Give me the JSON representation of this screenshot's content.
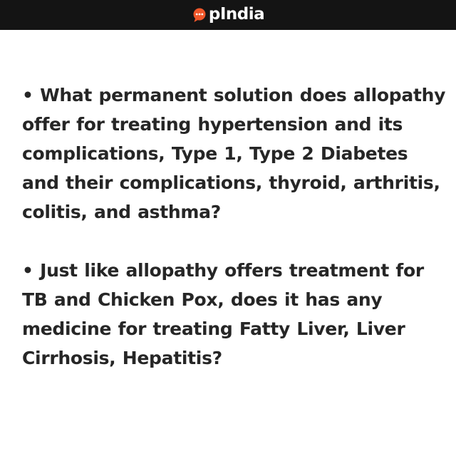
{
  "header": {
    "brand_name": "pIndia",
    "brand_icon": "speech-bubble-logo-icon",
    "background_color": "#141414",
    "accent_color": "#f0572a"
  },
  "content": {
    "bullet_symbol": "•",
    "paragraphs": [
      {
        "text": "What permanent solution does allopathy offer for treating hypertension and its complications, Type 1, Type 2 Diabetes and their complications, thyroid, arthritis, colitis, and asthma?"
      },
      {
        "text": "Just like allopathy offers treatment for TB and Chicken Pox, does it has any medicine for treating Fatty Liver, Liver Cirrhosis, Hepatitis?"
      }
    ]
  }
}
